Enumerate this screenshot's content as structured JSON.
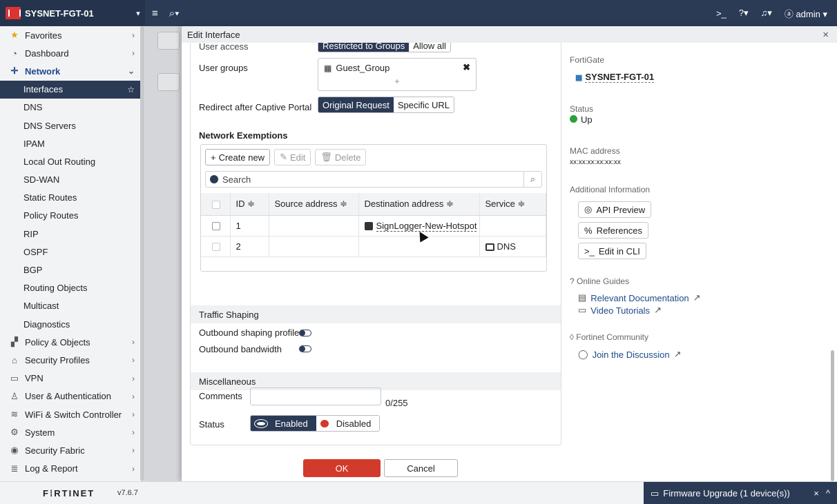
{
  "topbar": {
    "hostname": "SYSNET-FGT-01",
    "menu_icon": "≡",
    "search_icon": "⌕▾",
    "cli_icon": ">_",
    "help_icon": "?▾",
    "bell_icon": "♫▾",
    "user_label": "ⓐ admin ▾"
  },
  "sidebar": {
    "items": [
      {
        "label": "Favorites",
        "icon": "★"
      },
      {
        "label": "Dashboard",
        "icon": "◔"
      },
      {
        "label": "Network",
        "icon": "✛"
      },
      {
        "label": "Interfaces"
      },
      {
        "label": "DNS"
      },
      {
        "label": "DNS Servers"
      },
      {
        "label": "IPAM"
      },
      {
        "label": "Local Out Routing"
      },
      {
        "label": "SD-WAN"
      },
      {
        "label": "Static Routes"
      },
      {
        "label": "Policy Routes"
      },
      {
        "label": "RIP"
      },
      {
        "label": "OSPF"
      },
      {
        "label": "BGP"
      },
      {
        "label": "Routing Objects"
      },
      {
        "label": "Multicast"
      },
      {
        "label": "Diagnostics"
      },
      {
        "label": "Policy & Objects",
        "icon": "▞"
      },
      {
        "label": "Security Profiles",
        "icon": "⌂"
      },
      {
        "label": "VPN",
        "icon": "▭"
      },
      {
        "label": "User & Authentication",
        "icon": "♙"
      },
      {
        "label": "WiFi & Switch Controller",
        "icon": "≋"
      },
      {
        "label": "System",
        "icon": "⚙"
      },
      {
        "label": "Security Fabric",
        "icon": "◉"
      },
      {
        "label": "Log & Report",
        "icon": "≣"
      }
    ]
  },
  "footer": {
    "logo": "F⁞RTINET",
    "version": "v7.6.7",
    "firmware": "Firmware Upgrade (1 device(s))"
  },
  "panel": {
    "title": "Edit Interface",
    "user_access_label": "User access",
    "user_access_opt1": "Restricted to Groups",
    "user_access_opt2": "Allow all",
    "user_groups_label": "User groups",
    "user_group_value": "Guest_Group",
    "redirect_label": "Redirect after Captive Portal",
    "redirect_opt1": "Original Request",
    "redirect_opt2": "Specific URL",
    "network_exemptions_title": "Network Exemptions",
    "create_new": "Create new",
    "edit": "Edit",
    "delete": "Delete",
    "search_placeholder": "Search",
    "table": {
      "headers": [
        "ID ≑",
        "Source address ≑",
        "Destination address ≑",
        "Service ≑"
      ],
      "rows": [
        {
          "id": "1",
          "source": "",
          "destination": "SignLogger-New-Hotspot",
          "service": ""
        },
        {
          "id": "2",
          "source": "",
          "destination": "",
          "service": "DNS"
        }
      ]
    },
    "traffic_shaping_title": "Traffic Shaping",
    "outbound_profile_label": "Outbound shaping profile",
    "outbound_bandwidth_label": "Outbound bandwidth",
    "misc_title": "Miscellaneous",
    "comments_label": "Comments",
    "comments_count": "0/255",
    "status_label": "Status",
    "status_enabled": "Enabled",
    "status_disabled": "Disabled",
    "ok": "OK",
    "cancel": "Cancel"
  },
  "info": {
    "fortigate_label": "FortiGate",
    "fortigate_value": "SYSNET-FGT-01",
    "status_label": "Status",
    "status_value": "Up",
    "mac_label": "MAC address",
    "mac_value": "xx:xx:xx:xx:xx:xx",
    "additional_label": "Additional Information",
    "api_preview": "API Preview",
    "references": "References",
    "edit_cli": "Edit in CLI",
    "online_guides": "Online Guides",
    "relevant_docs": "Relevant Documentation",
    "video_tutorials": "Video Tutorials",
    "community": "Fortinet Community",
    "join_discussion": "Join the Discussion"
  },
  "colors": {
    "navy": "#2b3a55",
    "ok_red": "#d23a2b",
    "status_green": "#2e9e3e",
    "status_red": "#d23a2b"
  }
}
